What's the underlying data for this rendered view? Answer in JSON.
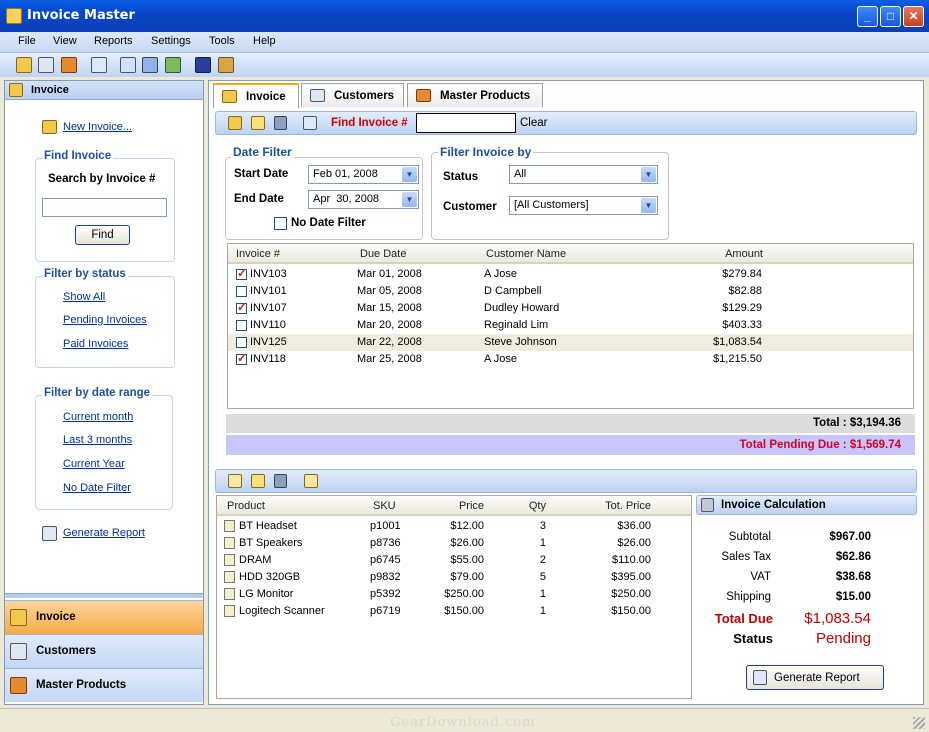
{
  "app": {
    "title": "Invoice Master"
  },
  "menu": [
    "File",
    "View",
    "Reports",
    "Settings",
    "Tools",
    "Help"
  ],
  "left": {
    "header": "Invoice",
    "new_invoice": "New Invoice...",
    "find_title": "Find Invoice",
    "search_label": "Search by Invoice #",
    "search_value": "",
    "find_button": "Find",
    "status_title": "Filter by status",
    "status_links": [
      "Show All",
      "Pending Invoices",
      "Paid Invoices"
    ],
    "date_title": "Filter by date range",
    "date_links": [
      "Current month",
      "Last 3 months",
      "Current Year",
      "No Date Filter"
    ],
    "generate_report": "Generate Report",
    "nav": [
      "Invoice",
      "Customers",
      "Master Products"
    ]
  },
  "tabs": [
    "Invoice",
    "Customers",
    "Master Products"
  ],
  "toolbar": {
    "find_label": "Find Invoice #",
    "find_value": "",
    "clear": "Clear"
  },
  "date_filter": {
    "title": "Date Filter",
    "start_label": "Start Date",
    "start_value": "Feb 01, 2008",
    "end_label": "End Date",
    "end_value": "Apr  30, 2008",
    "no_date_label": "No Date Filter"
  },
  "filter_by": {
    "title": "Filter Invoice by",
    "status_label": "Status",
    "status_value": "All",
    "customer_label": "Customer",
    "customer_value": "[All Customers]"
  },
  "invoices": {
    "columns": [
      "Invoice #",
      "Due Date",
      "Customer Name",
      "Amount"
    ],
    "rows": [
      {
        "checked": true,
        "id": "INV103",
        "due": "Mar 01, 2008",
        "customer": "A Jose",
        "amount": "$279.84"
      },
      {
        "checked": false,
        "id": "INV101",
        "due": "Mar 05, 2008",
        "customer": "D Campbell",
        "amount": "$82.88"
      },
      {
        "checked": true,
        "id": "INV107",
        "due": "Mar 15, 2008",
        "customer": "Dudley Howard",
        "amount": "$129.29"
      },
      {
        "checked": false,
        "id": "INV110",
        "due": "Mar 20, 2008",
        "customer": "Reginald Lim",
        "amount": "$403.33"
      },
      {
        "checked": false,
        "id": "INV125",
        "due": "Mar 22, 2008",
        "customer": "Steve Johnson",
        "amount": "$1,083.54"
      },
      {
        "checked": true,
        "id": "INV118",
        "due": "Mar 25, 2008",
        "customer": "A Jose",
        "amount": "$1,215.50"
      }
    ],
    "total": "Total : $3,194.36",
    "pending": "Total Pending Due : $1,569.74"
  },
  "products": {
    "columns": [
      "Product",
      "SKU",
      "Price",
      "Qty",
      "Tot. Price"
    ],
    "rows": [
      {
        "product": "BT Headset",
        "sku": "p1001",
        "price": "$12.00",
        "qty": "3",
        "total": "$36.00"
      },
      {
        "product": "BT Speakers",
        "sku": "p8736",
        "price": "$26.00",
        "qty": "1",
        "total": "$26.00"
      },
      {
        "product": "DRAM",
        "sku": "p6745",
        "price": "$55.00",
        "qty": "2",
        "total": "$110.00"
      },
      {
        "product": "HDD 320GB",
        "sku": "p9832",
        "price": "$79.00",
        "qty": "5",
        "total": "$395.00"
      },
      {
        "product": "LG Monitor",
        "sku": "p5392",
        "price": "$250.00",
        "qty": "1",
        "total": "$250.00"
      },
      {
        "product": "Logitech Scanner",
        "sku": "p6719",
        "price": "$150.00",
        "qty": "1",
        "total": "$150.00"
      }
    ]
  },
  "calc": {
    "title": "Invoice Calculation",
    "subtotal_label": "Subtotal",
    "subtotal": "$967.00",
    "tax_label": "Sales Tax",
    "tax": "$62.86",
    "vat_label": "VAT",
    "vat": "$38.68",
    "ship_label": "Shipping",
    "ship": "$15.00",
    "due_label": "Total Due",
    "due": "$1,083.54",
    "status_label": "Status",
    "status": "Pending",
    "report_button": "Generate Report"
  },
  "watermark": "GearDownload.com"
}
